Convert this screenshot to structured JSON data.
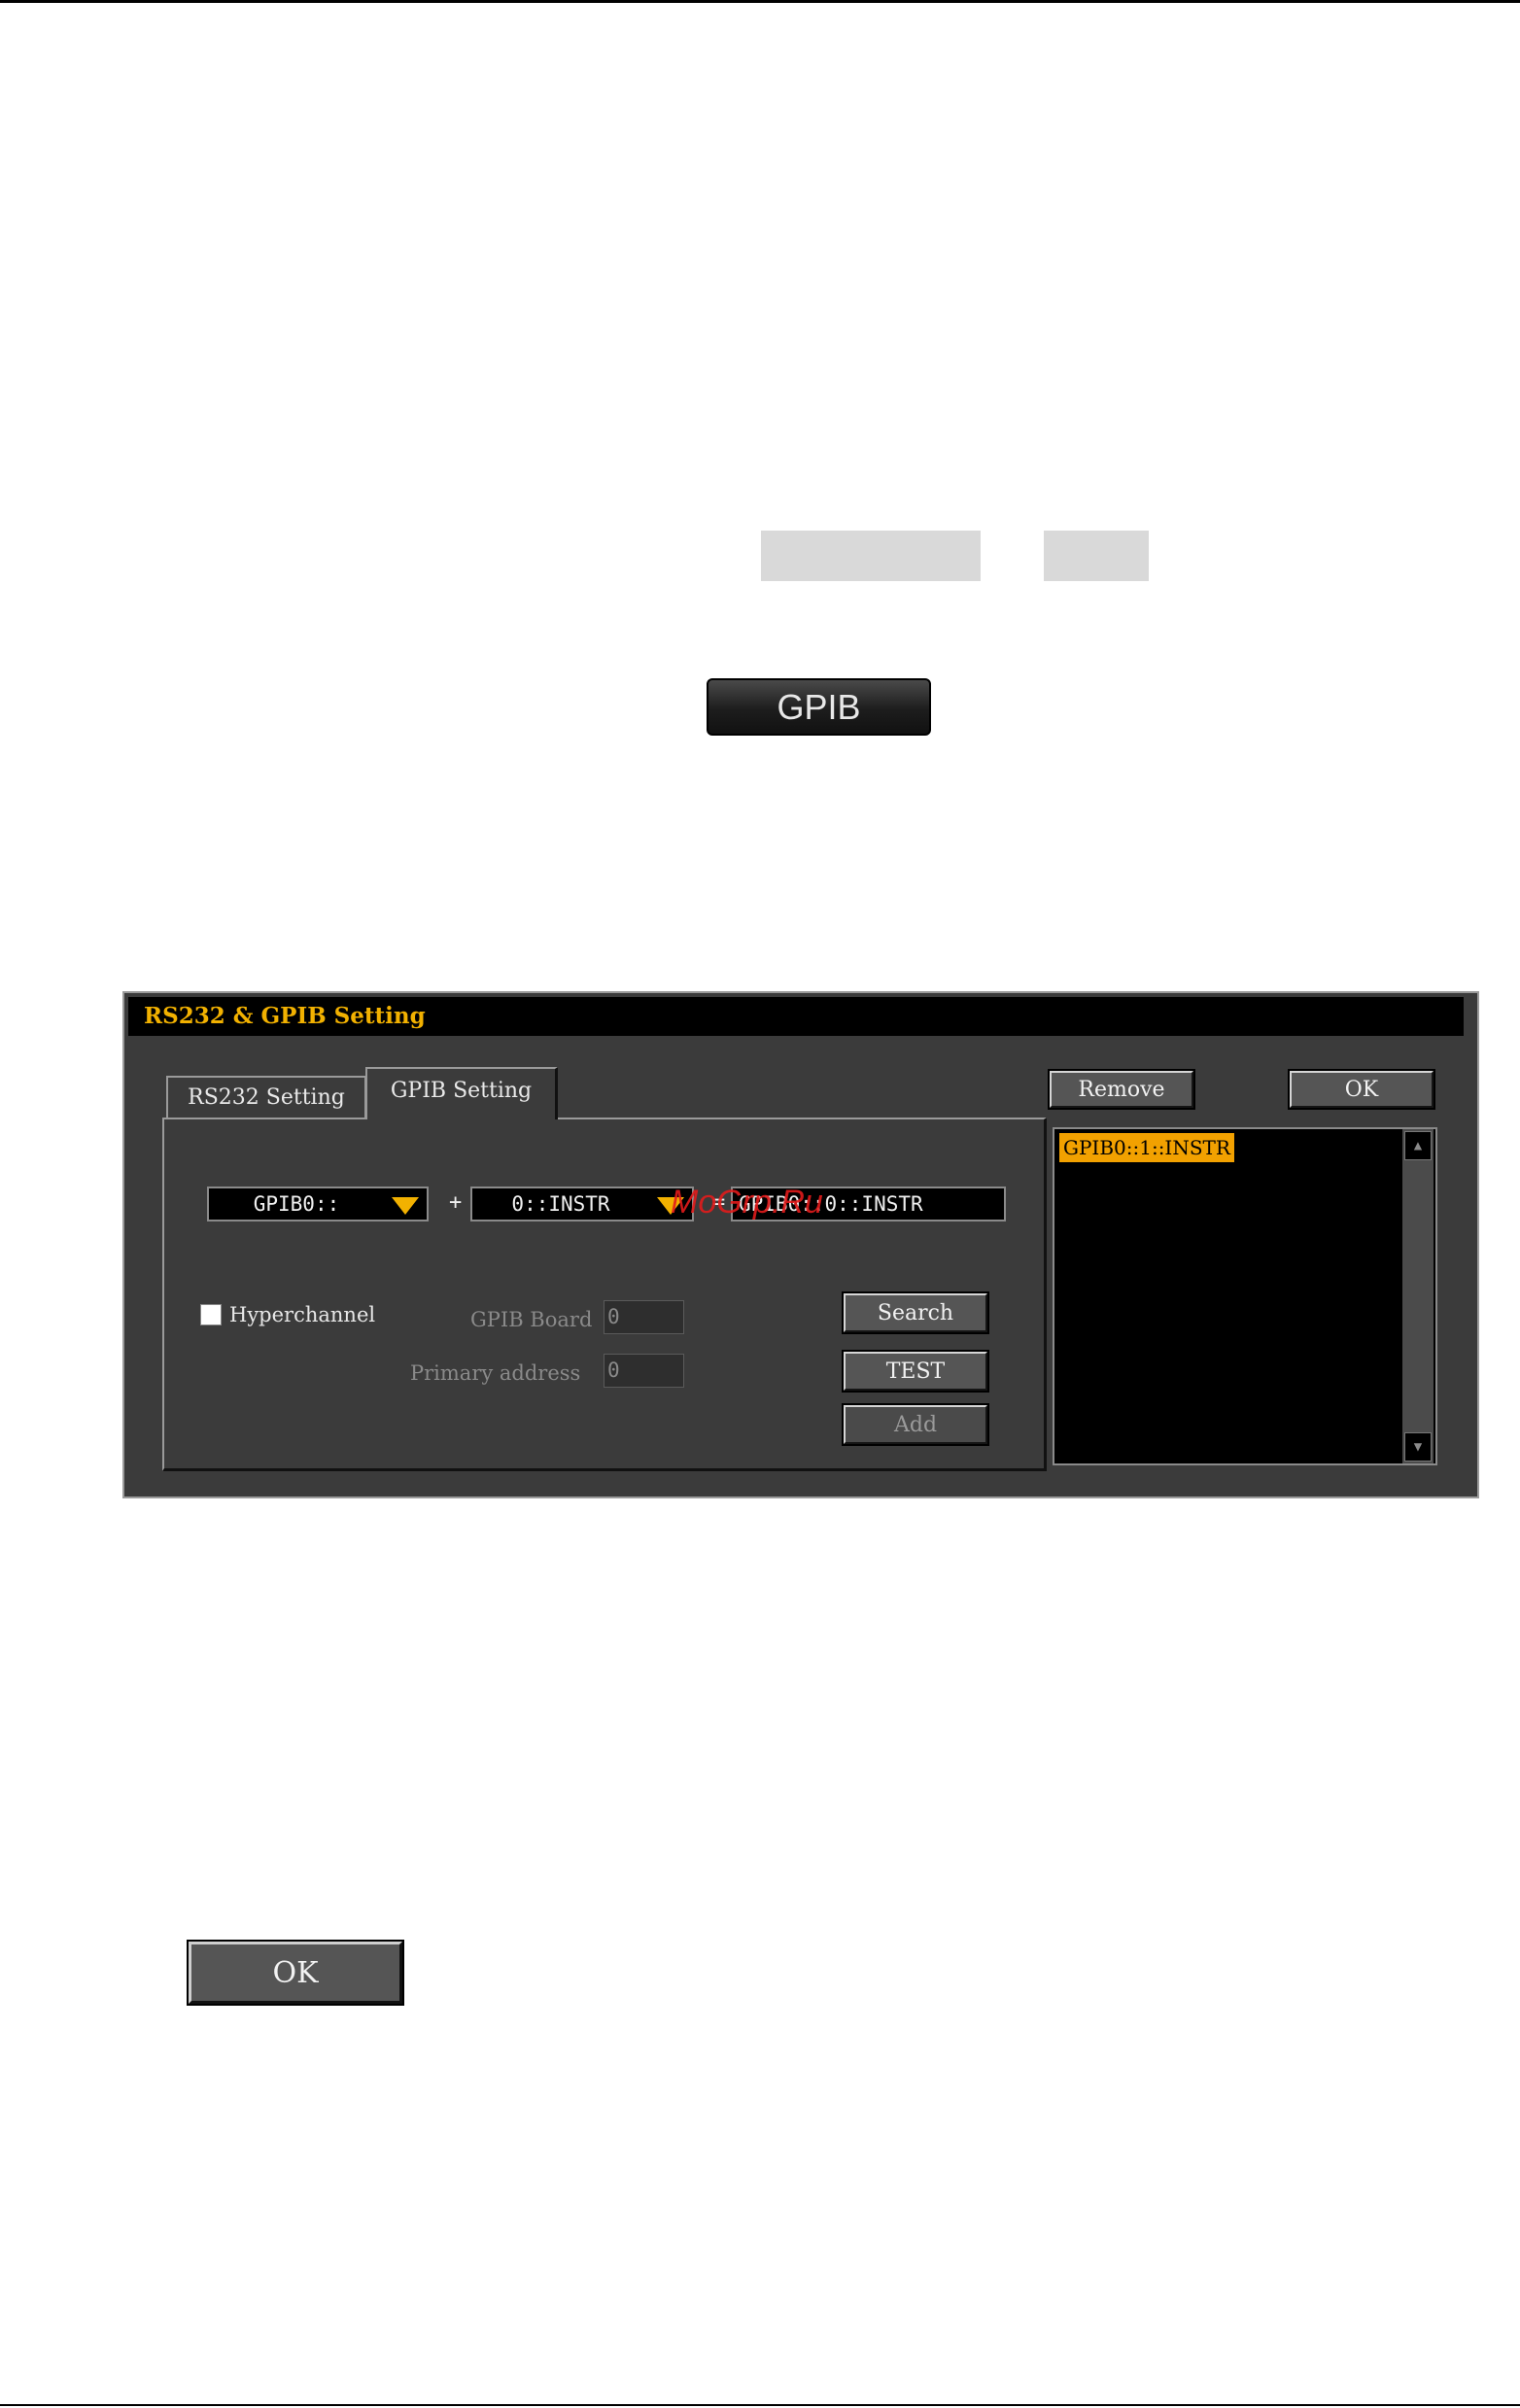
{
  "doc_key": {
    "label": "GPIB"
  },
  "dialog": {
    "title": "RS232 & GPIB Setting",
    "tabs": [
      {
        "label": "RS232 Setting",
        "active": false
      },
      {
        "label": "GPIB Setting",
        "active": true
      }
    ],
    "combo_board": "GPIB0::",
    "plus": "+",
    "combo_address": "0::INSTR",
    "equals": "=",
    "result": "GPIB0::0::INSTR",
    "hyperchannel_label": "Hyperchannel",
    "hyperchannel_checked": false,
    "gpib_board_label": "GPIB Board",
    "gpib_board_value": "0",
    "primary_address_label": "Primary address",
    "primary_address_value": "0",
    "buttons": {
      "search": "Search",
      "test": "TEST",
      "add": "Add",
      "remove": "Remove",
      "ok": "OK"
    },
    "list": [
      "GPIB0::1::INSTR"
    ],
    "scroll_up": "▲",
    "scroll_down": "▼"
  },
  "doc_ok": {
    "label": "OK"
  },
  "watermark": "ManualsLib-like",
  "watermark_text": "MoGrp.Ru",
  "colors": {
    "accent": "#f2b100",
    "list_highlight": "#f2a100",
    "panel_bg": "#3b3b3b"
  }
}
